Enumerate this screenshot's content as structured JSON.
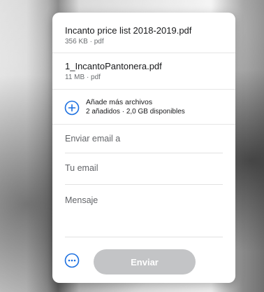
{
  "files": [
    {
      "name": "Incanto price list 2018-2019.pdf",
      "meta": "356 KB · pdf"
    },
    {
      "name": "1_IncantoPantonera.pdf",
      "meta": "11 MB · pdf"
    }
  ],
  "add_files": {
    "title": "Añade más archivos",
    "subtitle": "2 añadidos · 2,0 GB disponibles",
    "icon": "plus-circle-icon"
  },
  "form": {
    "email_to_placeholder": "Enviar email a",
    "your_email_placeholder": "Tu email",
    "message_placeholder": "Mensaje"
  },
  "footer": {
    "more_icon": "more-options-icon",
    "send_label": "Enviar"
  },
  "colors": {
    "accent": "#1b6fe0",
    "send_disabled": "#c3c4c6"
  }
}
